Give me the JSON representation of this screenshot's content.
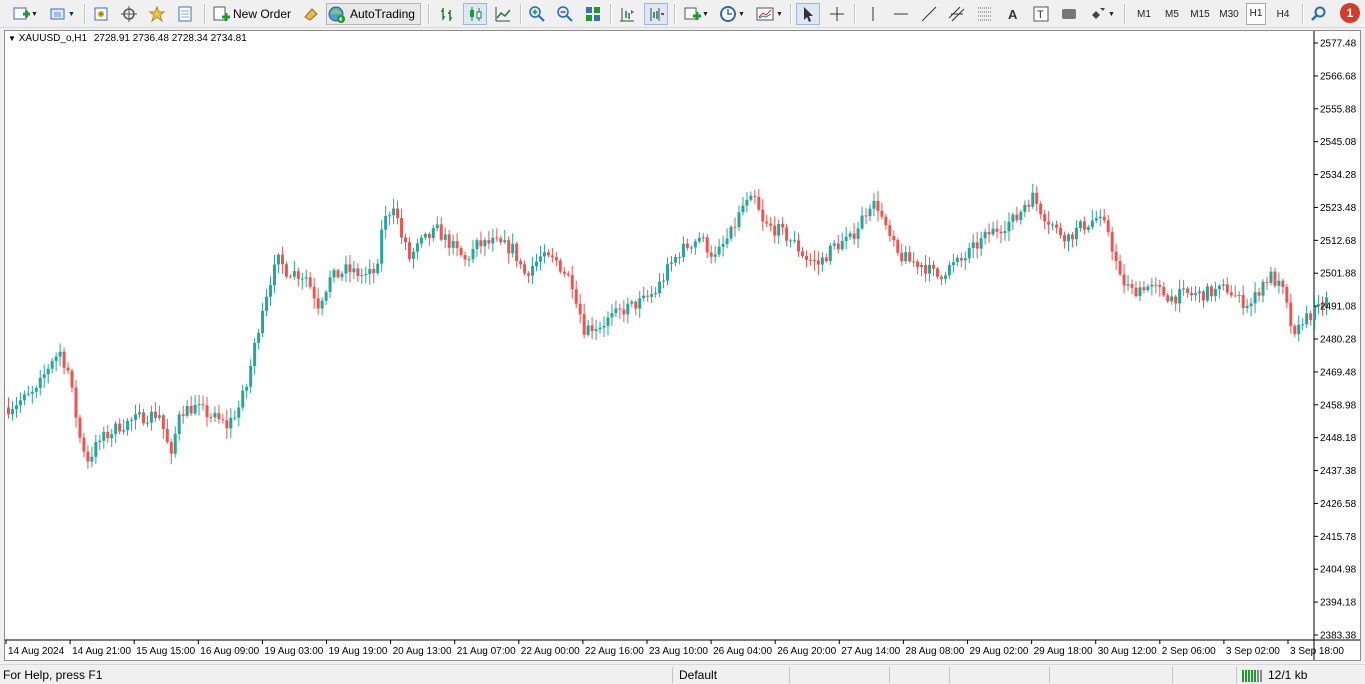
{
  "toolbar": {
    "new_order_label": "New Order",
    "autotrading_label": "AutoTrading",
    "timeframes": [
      "M1",
      "M5",
      "M15",
      "M30",
      "H1",
      "H4"
    ],
    "active_timeframe": "H1",
    "alert_count": "1",
    "icons": [
      "new-chart-icon",
      "profiles-icon",
      "market-watch-icon",
      "data-window-icon",
      "navigator-icon",
      "terminal-icon",
      "new-order-icon",
      "metaeditor-icon",
      "autotrading-icon",
      "bar-chart-icon",
      "candlestick-icon",
      "line-chart-icon",
      "zoom-in-icon",
      "zoom-out-icon",
      "tile-windows-icon",
      "chart-shift-icon",
      "autoscroll-icon",
      "indicators-icon",
      "periods-icon",
      "templates-icon",
      "cursor-icon",
      "crosshair-icon",
      "vertical-line-icon",
      "horizontal-line-icon",
      "trendline-icon",
      "fibonacci-icon",
      "channel-icon",
      "text-icon",
      "text-label-icon",
      "rectangle-icon",
      "arrows-icon",
      "search-icon",
      "alert-icon"
    ]
  },
  "chart": {
    "title": "XAUUSD_o,H1",
    "ohlc": "2728.91 2736.48 2728.34 2734.81",
    "colors": {
      "bull": "#26a69a",
      "bear": "#ef5350",
      "background": "#ffffff",
      "axis": "#000000"
    },
    "price_ticks": [
      "2577.48",
      "2566.68",
      "2555.88",
      "2545.08",
      "2534.28",
      "2523.48",
      "2512.68",
      "2501.88",
      "2491.08",
      "2480.28",
      "2469.48",
      "2458.98",
      "2448.18",
      "2437.38",
      "2426.58",
      "2415.78",
      "2404.98",
      "2394.18",
      "2383.38"
    ],
    "time_ticks": [
      "14 Aug 2024",
      "14 Aug 21:00",
      "15 Aug 15:00",
      "16 Aug 09:00",
      "19 Aug 03:00",
      "19 Aug 19:00",
      "20 Aug 13:00",
      "21 Aug 07:00",
      "22 Aug 00:00",
      "22 Aug 16:00",
      "23 Aug 10:00",
      "26 Aug 04:00",
      "26 Aug 20:00",
      "27 Aug 14:00",
      "28 Aug 08:00",
      "29 Aug 02:00",
      "29 Aug 18:00",
      "30 Aug 12:00",
      "2 Sep 06:00",
      "3 Sep 02:00",
      "3 Sep 18:00"
    ]
  },
  "chart_data": {
    "type": "candlestick",
    "symbol": "XAUUSD_o",
    "timeframe": "H1",
    "y_range": [
      2383.38,
      2577.48
    ],
    "close_path": [
      [
        0,
        2458
      ],
      [
        7,
        2463
      ],
      [
        11,
        2474
      ],
      [
        13,
        2476
      ],
      [
        15,
        2470
      ],
      [
        18,
        2448
      ],
      [
        20,
        2441
      ],
      [
        23,
        2447
      ],
      [
        28,
        2452
      ],
      [
        34,
        2455
      ],
      [
        38,
        2456
      ],
      [
        40,
        2446
      ],
      [
        41,
        2441
      ],
      [
        43,
        2457
      ],
      [
        47,
        2458
      ],
      [
        50,
        2456
      ],
      [
        55,
        2452
      ],
      [
        58,
        2458
      ],
      [
        60,
        2465
      ],
      [
        62,
        2478
      ],
      [
        64,
        2491
      ],
      [
        66,
        2500
      ],
      [
        68,
        2506
      ],
      [
        70,
        2503
      ],
      [
        75,
        2501
      ],
      [
        78,
        2492
      ],
      [
        81,
        2500
      ],
      [
        85,
        2503
      ],
      [
        90,
        2501
      ],
      [
        93,
        2503
      ],
      [
        94,
        2517
      ],
      [
        97,
        2525
      ],
      [
        99,
        2514
      ],
      [
        101,
        2507
      ],
      [
        104,
        2512
      ],
      [
        108,
        2516
      ],
      [
        111,
        2512
      ],
      [
        115,
        2506
      ],
      [
        118,
        2511
      ],
      [
        122,
        2512
      ],
      [
        127,
        2510
      ],
      [
        130,
        2502
      ],
      [
        134,
        2507
      ],
      [
        138,
        2506
      ],
      [
        142,
        2499
      ],
      [
        145,
        2484
      ],
      [
        149,
        2485
      ],
      [
        155,
        2490
      ],
      [
        160,
        2493
      ],
      [
        163,
        2496
      ],
      [
        166,
        2503
      ],
      [
        169,
        2509
      ],
      [
        174,
        2514
      ],
      [
        178,
        2507
      ],
      [
        182,
        2515
      ],
      [
        185,
        2524
      ],
      [
        188,
        2526
      ],
      [
        190,
        2518
      ],
      [
        194,
        2516
      ],
      [
        197,
        2513
      ],
      [
        201,
        2507
      ],
      [
        204,
        2505
      ],
      [
        208,
        2511
      ],
      [
        212,
        2513
      ],
      [
        215,
        2520
      ],
      [
        217,
        2525
      ],
      [
        219,
        2524
      ],
      [
        221,
        2516
      ],
      [
        224,
        2508
      ],
      [
        227,
        2506
      ],
      [
        230,
        2505
      ],
      [
        234,
        2501
      ],
      [
        237,
        2504
      ],
      [
        240,
        2506
      ],
      [
        243,
        2510
      ],
      [
        247,
        2515
      ],
      [
        251,
        2518
      ],
      [
        254,
        2520
      ],
      [
        256,
        2525
      ],
      [
        258,
        2527
      ],
      [
        261,
        2521
      ],
      [
        264,
        2516
      ],
      [
        267,
        2514
      ],
      [
        270,
        2517
      ],
      [
        274,
        2520
      ],
      [
        277,
        2516
      ],
      [
        280,
        2500
      ],
      [
        283,
        2496
      ],
      [
        286,
        2498
      ],
      [
        290,
        2496
      ],
      [
        293,
        2494
      ],
      [
        296,
        2495
      ],
      [
        300,
        2495
      ],
      [
        304,
        2496
      ],
      [
        307,
        2497
      ],
      [
        310,
        2493
      ],
      [
        313,
        2492
      ],
      [
        316,
        2499
      ],
      [
        318,
        2501
      ],
      [
        321,
        2496
      ],
      [
        324,
        2480
      ],
      [
        326,
        2487
      ],
      [
        330,
        2490
      ],
      [
        332,
        2493
      ]
    ],
    "last_bar": {
      "open": 2728.91,
      "high": 2736.48,
      "low": 2728.34,
      "close": 2734.81
    }
  },
  "status": {
    "help": "For Help, press F1",
    "profile": "Default",
    "traffic": "12/1 kb"
  }
}
